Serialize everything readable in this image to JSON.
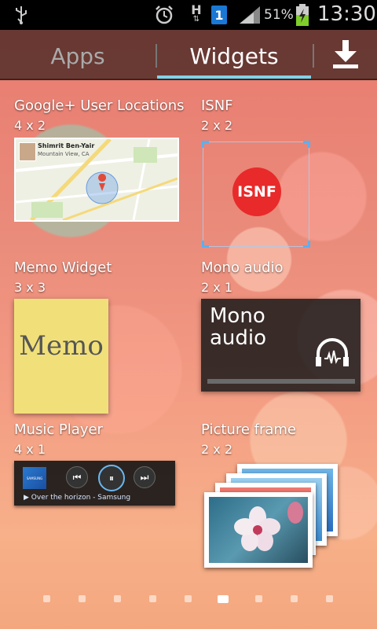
{
  "statusbar": {
    "battery_percent": "51%",
    "time": "13:30",
    "network_label": "H",
    "notification_count": "1",
    "icons": [
      "usb-icon",
      "alarm-icon",
      "data-transfer-icon",
      "notification-badge-icon",
      "signal-icon",
      "battery-charging-icon"
    ]
  },
  "tabs": {
    "apps": "Apps",
    "widgets": "Widgets",
    "selected": "Widgets",
    "download_icon": "download-icon"
  },
  "widgets": [
    {
      "name": "Google+ User Locations",
      "size": "4 x 2",
      "preview": {
        "person": "Shimrit Ben-Yair",
        "place": "Mountain View, CA"
      }
    },
    {
      "name": "ISNF",
      "size": "2 x 2",
      "preview": {
        "badge": "ISNF"
      }
    },
    {
      "name": "Memo Widget",
      "size": "3 x 3",
      "preview": {
        "text": "Memo"
      }
    },
    {
      "name": "Mono audio",
      "size": "2 x 1",
      "preview": {
        "text": "Mono\naudio"
      }
    },
    {
      "name": "Music Player",
      "size": "4 x 1",
      "preview": {
        "track": "Over the horizon - Samsung",
        "album_label": "SAMSUNG"
      }
    },
    {
      "name": "Picture frame",
      "size": "2 x 2"
    }
  ],
  "pager": {
    "page_count": 9,
    "current_page": 6
  },
  "colors": {
    "accent": "#7fd3e8",
    "isnf_red": "#e82a2a",
    "memo_yellow": "#f1e07a"
  }
}
